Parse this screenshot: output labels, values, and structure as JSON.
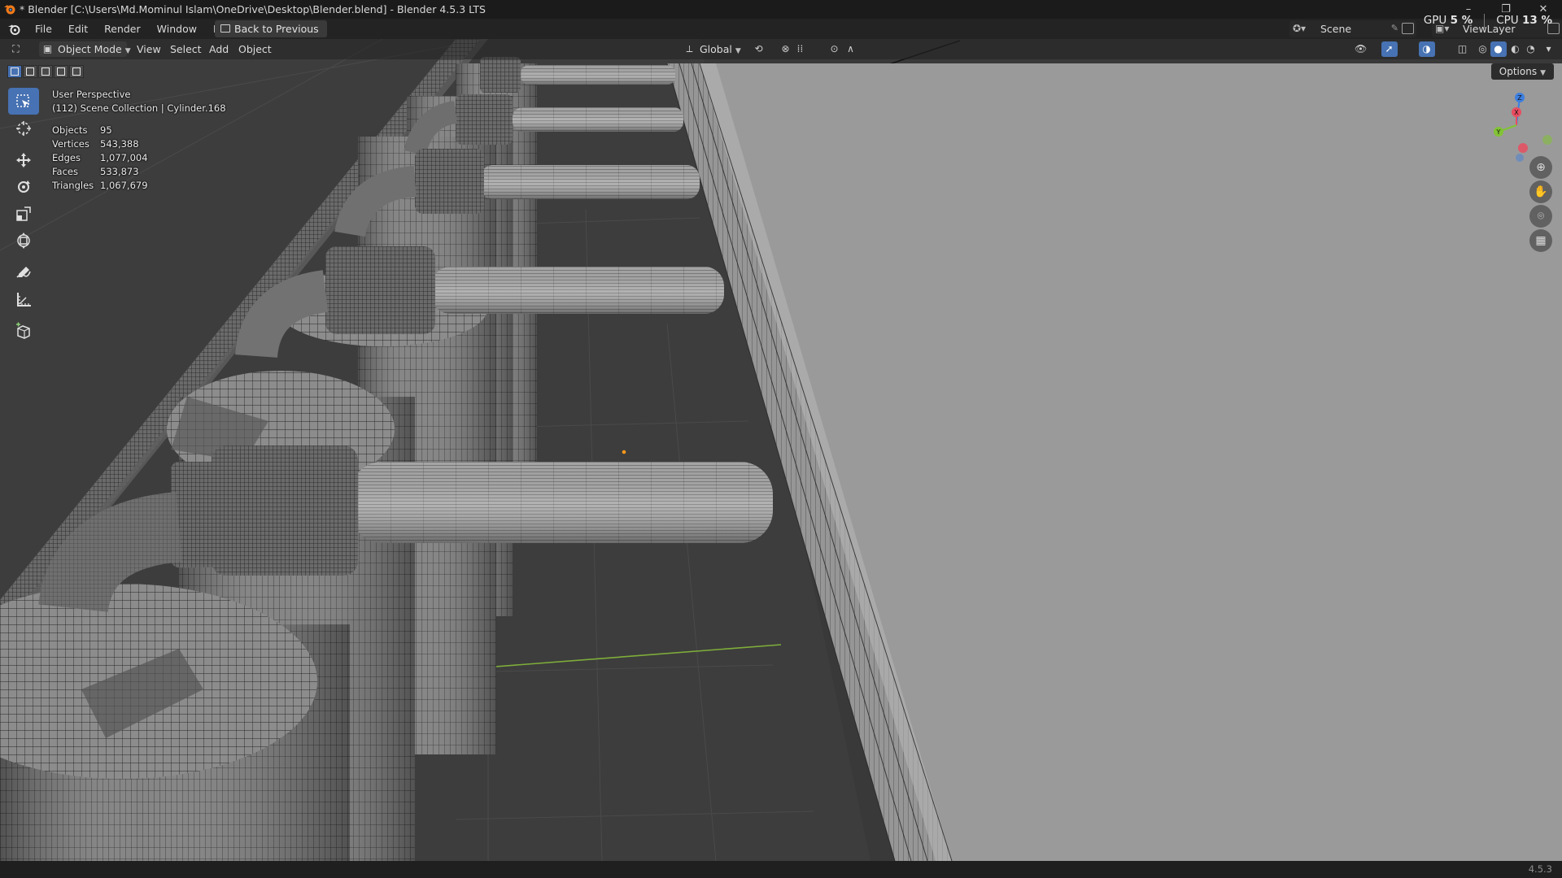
{
  "window": {
    "title": "* Blender [C:\\Users\\Md.Mominul Islam\\OneDrive\\Desktop\\Blender.blend] - Blender 4.5.3 LTS",
    "controls": [
      "–",
      "❐",
      "✕"
    ]
  },
  "topbar": {
    "menus": [
      "File",
      "Edit",
      "Render",
      "Window",
      "Help"
    ],
    "back_button": "Back to Previous",
    "scene": "Scene",
    "view_layer": "ViewLayer",
    "gpu_label": "GPU",
    "gpu_value": "5 %",
    "cpu_label": "CPU",
    "cpu_value": "13 %"
  },
  "viewport_header": {
    "mode": "Object Mode",
    "menus": [
      "View",
      "Select",
      "Add",
      "Object"
    ],
    "orientation": "Global",
    "options_label": "Options"
  },
  "overlay": {
    "perspective": "User Perspective",
    "collection": "(112) Scene Collection | Cylinder.168",
    "stats": [
      {
        "label": "Objects",
        "value": "95"
      },
      {
        "label": "Vertices",
        "value": "543,388"
      },
      {
        "label": "Edges",
        "value": "1,077,004"
      },
      {
        "label": "Faces",
        "value": "533,873"
      },
      {
        "label": "Triangles",
        "value": "1,067,679"
      }
    ]
  },
  "gizmo": {
    "x": "X",
    "y": "Y",
    "z": "Z"
  },
  "statusbar": {
    "version": "4.5.3"
  },
  "colors": {
    "accent": "#4772b3",
    "viewport_bg": "#3a3a3a",
    "grid_y_axis": "#7fae3a",
    "axis_x": "#e84d5f",
    "axis_y": "#82c335",
    "axis_z": "#3d7fe0"
  }
}
